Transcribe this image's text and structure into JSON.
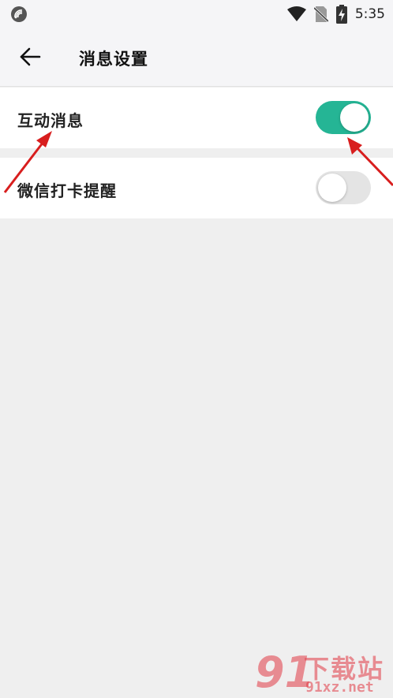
{
  "status_bar": {
    "time": "5:35",
    "icons": [
      "signal-app-icon",
      "wifi-icon",
      "no-sim-icon",
      "battery-charging-icon"
    ]
  },
  "app_bar": {
    "back_icon": "arrow-left-icon",
    "title": "消息设置"
  },
  "settings": [
    {
      "label": "互动消息",
      "enabled": true
    },
    {
      "label": "微信打卡提醒",
      "enabled": false
    }
  ],
  "colors": {
    "toggle_on": "#25b595",
    "toggle_off": "#e4e4e4",
    "arrow": "#d81e1e",
    "background": "#efefef"
  },
  "watermark": {
    "logo": "91",
    "title": "下载站",
    "url": "91xz.net"
  }
}
